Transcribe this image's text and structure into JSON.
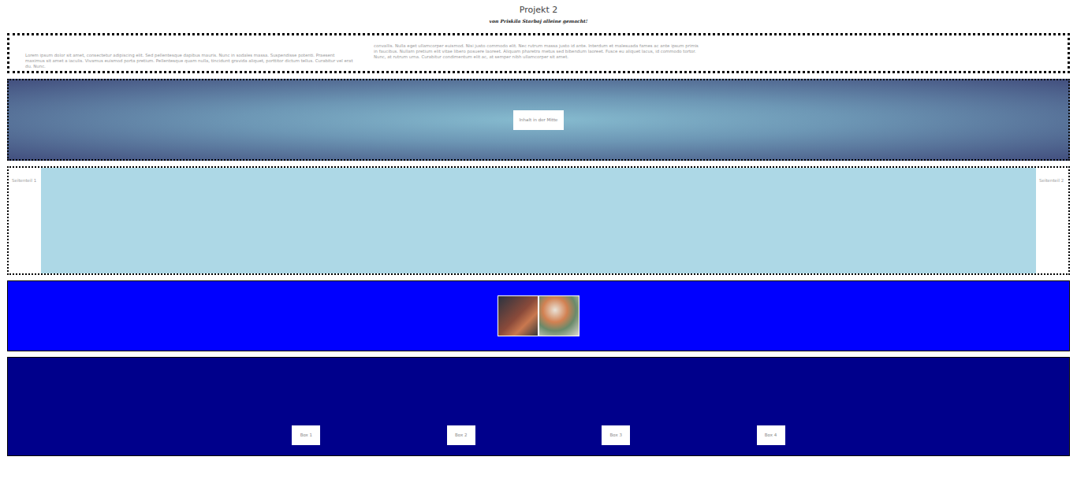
{
  "header": {
    "title": "Projekt 2",
    "subtitle": "von Priskila Starbaj alleine gemacht!"
  },
  "intro": {
    "columns": [
      "Lorem ipsum dolor sit amet, consectetur adipiscing elit. Sed pellentesque dapibus mauris. Nunc in sodales massa. Suspendisse potenti. Praesent maximus sit amet a iaculis. Vivamus euismod porta pretium. Pellentesque quam nulla, tincidunt gravida aliquet, porttitor dictum tellus. Curabitur vel erat du. Nunc.",
      "convallis. Nulla eget ullamcorper euismod. Nisi justo commodo elit. Nec rutrum massa justo id ante. Interdum et malesuada fames ac ante ipsum primis in faucibus. Nullam pretium elit vitae libero posuere laoreet. Aliquam pharetra metus sed bibendum laoreet. Fusce eu aliquet lacus, id commodo tortor. Nunc, at rutrum urna. Curabitur condimentum elit ac, at semper nibh ullamcorper sit amet."
    ]
  },
  "hero": {
    "text": "Inhalt in der Mitte"
  },
  "sides": [
    "Seitenteil 1",
    "Seitenteil 2"
  ],
  "boxes": [
    "Box 1",
    "Box 2",
    "Box 3",
    "Box 4"
  ]
}
